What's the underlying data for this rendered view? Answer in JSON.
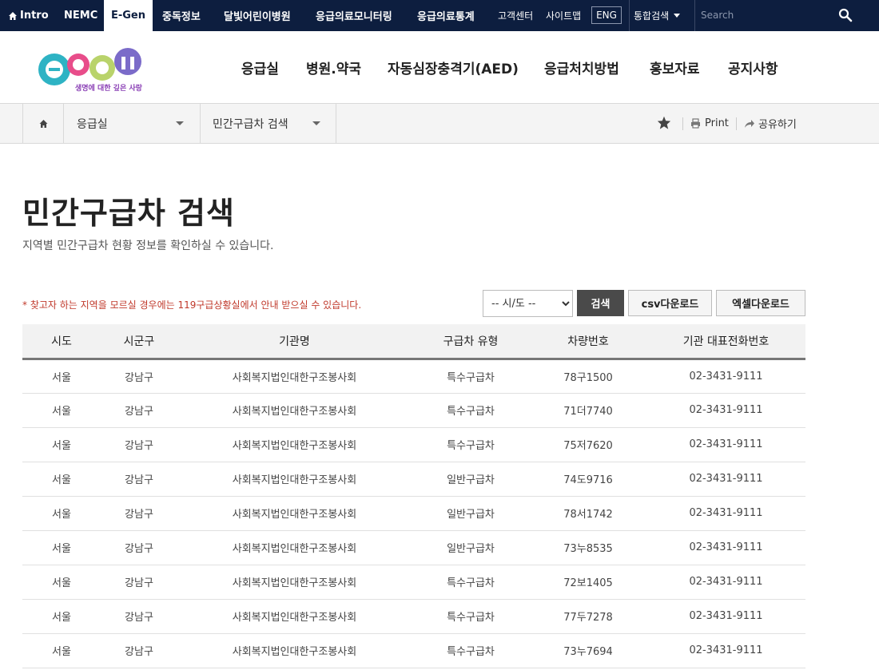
{
  "topbar": {
    "nav": [
      {
        "label": "Intro",
        "icon": "home-icon"
      },
      {
        "label": "NEMC"
      },
      {
        "label": "E-Gen",
        "active": true
      },
      {
        "label": "중독정보"
      },
      {
        "label": "달빛어린이병원"
      },
      {
        "label": "응급의료모니터링"
      },
      {
        "label": "응급의료통계"
      }
    ],
    "customer_center": "고객센터",
    "sitemap": "사이트맵",
    "eng": "ENG",
    "integrated_search": "통합검색",
    "search_placeholder": "Search"
  },
  "header": {
    "logo_text": "E-Gen",
    "logo_tagline": "생명에 대한 깊은 사랑",
    "main_nav": [
      "응급실",
      "병원.약국",
      "자동심장충격기(AED)",
      "응급처치방법",
      "홍보자료",
      "공지사항"
    ]
  },
  "breadcrumb": {
    "level1": "응급실",
    "level2": "민간구급차 검색",
    "print": "Print",
    "share": "공유하기"
  },
  "page": {
    "title": "민간구급차 검색",
    "subtitle": "지역별 민간구급차 현황 정보를 확인하실 수 있습니다.",
    "notice": "* 찾고자 하는 지역을 모르실 경우에는 119구급상황실에서 안내 받으실 수 있습니다.",
    "region_select": "-- 시/도 --",
    "search_button": "검색",
    "csv_button": "csv다운로드",
    "excel_button": "엑셀다운로드"
  },
  "table": {
    "headers": [
      "시도",
      "시군구",
      "기관명",
      "구급차 유형",
      "차량번호",
      "기관 대표전화번호"
    ],
    "rows": [
      [
        "서울",
        "강남구",
        "사회복지법인대한구조봉사회",
        "특수구급차",
        "78구1500",
        "02-3431-9111"
      ],
      [
        "서울",
        "강남구",
        "사회복지법인대한구조봉사회",
        "특수구급차",
        "71더7740",
        "02-3431-9111"
      ],
      [
        "서울",
        "강남구",
        "사회복지법인대한구조봉사회",
        "특수구급차",
        "75저7620",
        "02-3431-9111"
      ],
      [
        "서울",
        "강남구",
        "사회복지법인대한구조봉사회",
        "일반구급차",
        "74도9716",
        "02-3431-9111"
      ],
      [
        "서울",
        "강남구",
        "사회복지법인대한구조봉사회",
        "일반구급차",
        "78서1742",
        "02-3431-9111"
      ],
      [
        "서울",
        "강남구",
        "사회복지법인대한구조봉사회",
        "일반구급차",
        "73누8535",
        "02-3431-9111"
      ],
      [
        "서울",
        "강남구",
        "사회복지법인대한구조봉사회",
        "특수구급차",
        "72보1405",
        "02-3431-9111"
      ],
      [
        "서울",
        "강남구",
        "사회복지법인대한구조봉사회",
        "특수구급차",
        "77두7278",
        "02-3431-9111"
      ],
      [
        "서울",
        "강남구",
        "사회복지법인대한구조봉사회",
        "특수구급차",
        "73누7694",
        "02-3431-9111"
      ]
    ]
  },
  "colors": {
    "topbar_bg": "#0d1e3f",
    "notice_red": "#c0392b",
    "dark_button": "#4a4a4a"
  }
}
